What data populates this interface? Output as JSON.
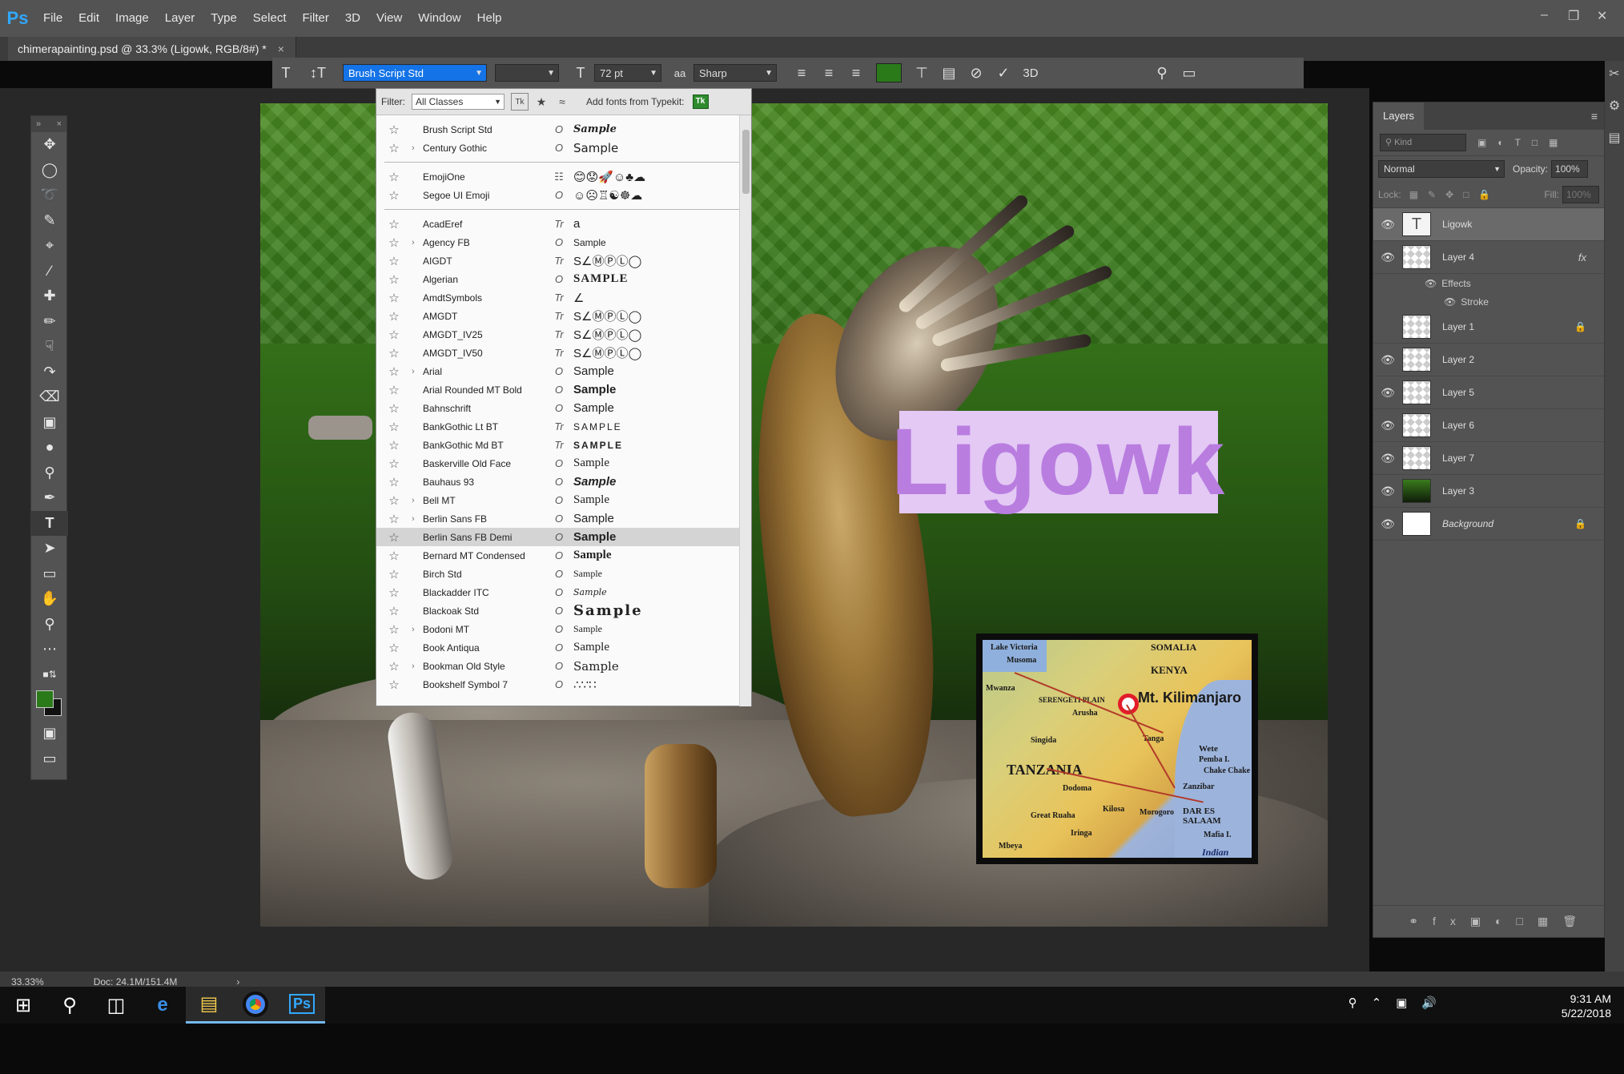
{
  "app": {
    "logo": "Ps",
    "menu": [
      "File",
      "Edit",
      "Image",
      "Layer",
      "Type",
      "Select",
      "Filter",
      "3D",
      "View",
      "Window",
      "Help"
    ],
    "window_controls": [
      "–",
      "❐",
      "✕"
    ]
  },
  "document": {
    "tab_title": "chimerapainting.psd @ 33.3% (Ligowk, RGB/8#) *",
    "close": "×"
  },
  "options_bar": {
    "font_family": "Brush Script Std",
    "font_size": "72 pt",
    "anti_alias": "Sharp",
    "text_color": "#2a7a1a",
    "threeD": "3D"
  },
  "font_panel": {
    "filter_label": "Filter:",
    "filter_value": "All Classes",
    "typekit_label": "Add fonts from Typekit:",
    "tk_badge": "Tk",
    "groups": [
      [
        {
          "name": "Brush Script Std",
          "type": "O",
          "sample": "Sample",
          "expand": false
        },
        {
          "name": "Century Gothic",
          "type": "O",
          "sample": "Sample",
          "expand": true
        }
      ],
      [
        {
          "name": "EmojiOne",
          "type": "☷",
          "sample": "😊😟🚀☺♣☁",
          "expand": false
        },
        {
          "name": "Segoe UI Emoji",
          "type": "O",
          "sample": "☺☹♖☯☸☁",
          "expand": false
        }
      ],
      [
        {
          "name": "AcadEref",
          "type": "Tr",
          "sample": "a",
          "expand": false
        },
        {
          "name": "Agency FB",
          "type": "O",
          "sample": "Sample",
          "expand": true
        },
        {
          "name": "AIGDT",
          "type": "Tr",
          "sample": "S∠ⓂⓅⓁ◯",
          "expand": false
        },
        {
          "name": "Algerian",
          "type": "O",
          "sample": "SAMPLE",
          "expand": false
        },
        {
          "name": "AmdtSymbols",
          "type": "Tr",
          "sample": "∠",
          "expand": false
        },
        {
          "name": "AMGDT",
          "type": "Tr",
          "sample": "S∠ⓂⓅⓁ◯",
          "expand": false
        },
        {
          "name": "AMGDT_IV25",
          "type": "Tr",
          "sample": "S∠ⓂⓅⓁ◯",
          "expand": false
        },
        {
          "name": "AMGDT_IV50",
          "type": "Tr",
          "sample": "S∠ⓂⓅⓁ◯",
          "expand": false
        },
        {
          "name": "Arial",
          "type": "O",
          "sample": "Sample",
          "expand": true
        },
        {
          "name": "Arial Rounded MT Bold",
          "type": "O",
          "sample": "Sample",
          "expand": false
        },
        {
          "name": "Bahnschrift",
          "type": "O",
          "sample": "Sample",
          "expand": false
        },
        {
          "name": "BankGothic Lt BT",
          "type": "Tr",
          "sample": "SAMPLE",
          "expand": false
        },
        {
          "name": "BankGothic Md BT",
          "type": "Tr",
          "sample": "SAMPLE",
          "expand": false
        },
        {
          "name": "Baskerville Old Face",
          "type": "O",
          "sample": "Sample",
          "expand": false
        },
        {
          "name": "Bauhaus 93",
          "type": "O",
          "sample": "Sample",
          "expand": false
        },
        {
          "name": "Bell MT",
          "type": "O",
          "sample": "Sample",
          "expand": true
        },
        {
          "name": "Berlin Sans FB",
          "type": "O",
          "sample": "Sample",
          "expand": true
        },
        {
          "name": "Berlin Sans FB Demi",
          "type": "O",
          "sample": "Sample",
          "expand": false,
          "selected": true
        },
        {
          "name": "Bernard MT Condensed",
          "type": "O",
          "sample": "Sample",
          "expand": false
        },
        {
          "name": "Birch Std",
          "type": "O",
          "sample": "Sample",
          "expand": false
        },
        {
          "name": "Blackadder ITC",
          "type": "O",
          "sample": "Sample",
          "expand": false
        },
        {
          "name": "Blackoak Std",
          "type": "O",
          "sample": "Sample",
          "expand": false
        },
        {
          "name": "Bodoni MT",
          "type": "O",
          "sample": "Sample",
          "expand": true
        },
        {
          "name": "Book Antiqua",
          "type": "O",
          "sample": "Sample",
          "expand": false
        },
        {
          "name": "Bookman Old Style",
          "type": "O",
          "sample": "Sample",
          "expand": true
        },
        {
          "name": "Bookshelf Symbol 7",
          "type": "O",
          "sample": "∴∵∷",
          "expand": false
        }
      ]
    ]
  },
  "canvas": {
    "ligowk_text": "Ligowk",
    "map": {
      "labels": {
        "somalia": "SOMALIA",
        "kenya": "KENYA",
        "kili": "Mt. Kilimanjaro",
        "tanzania": "TANZANIA",
        "dar": "DAR ES SALAAM",
        "indian": "Indian",
        "zanzibar": "Zanzibar",
        "wete": "Wete",
        "pemba": "Pemba I.",
        "chake": "Chake Chake",
        "lake_victoria": "Lake Victoria",
        "musoma": "Musoma",
        "mwanza": "Mwanza",
        "serengeti": "SERENGETI PLAIN",
        "dodoma": "Dodoma",
        "singida": "Singida",
        "tanga": "Tanga",
        "arusha": "Arusha",
        "morogoro": "Morogoro",
        "mbeya": "Mbeya",
        "iringa": "Iringa",
        "kilosa": "Kilosa",
        "great_ruaha": "Great Ruaha",
        "mafia": "Mafia I."
      }
    }
  },
  "layers_panel": {
    "tab": "Layers",
    "kind_placeholder": "Kind",
    "blend_mode": "Normal",
    "opacity_label": "Opacity:",
    "opacity_value": "100%",
    "lock_label": "Lock:",
    "fill_label": "Fill:",
    "fill_value": "100%",
    "layers": [
      {
        "name": "Ligowk",
        "thumb": "type",
        "visible": true,
        "selected": true
      },
      {
        "name": "Layer 4",
        "thumb": "checker",
        "visible": true,
        "fx": "fx"
      },
      {
        "name": "Layer 1",
        "thumb": "checker",
        "visible": false,
        "lock": true
      },
      {
        "name": "Layer 2",
        "thumb": "checker",
        "visible": true
      },
      {
        "name": "Layer 5",
        "thumb": "checker",
        "visible": true
      },
      {
        "name": "Layer 6",
        "thumb": "checker",
        "visible": true
      },
      {
        "name": "Layer 7",
        "thumb": "checker",
        "visible": true
      },
      {
        "name": "Layer 3",
        "thumb": "green",
        "visible": true
      },
      {
        "name": "Background",
        "thumb": "white",
        "visible": true,
        "lock": true,
        "italic": true
      }
    ],
    "effects_label": "Effects",
    "stroke_label": "Stroke"
  },
  "status": {
    "zoom": "33.33%",
    "doc": "Doc: 24.1M/151.4M"
  },
  "taskbar": {
    "time": "9:31 AM",
    "date": "5/22/2018"
  }
}
